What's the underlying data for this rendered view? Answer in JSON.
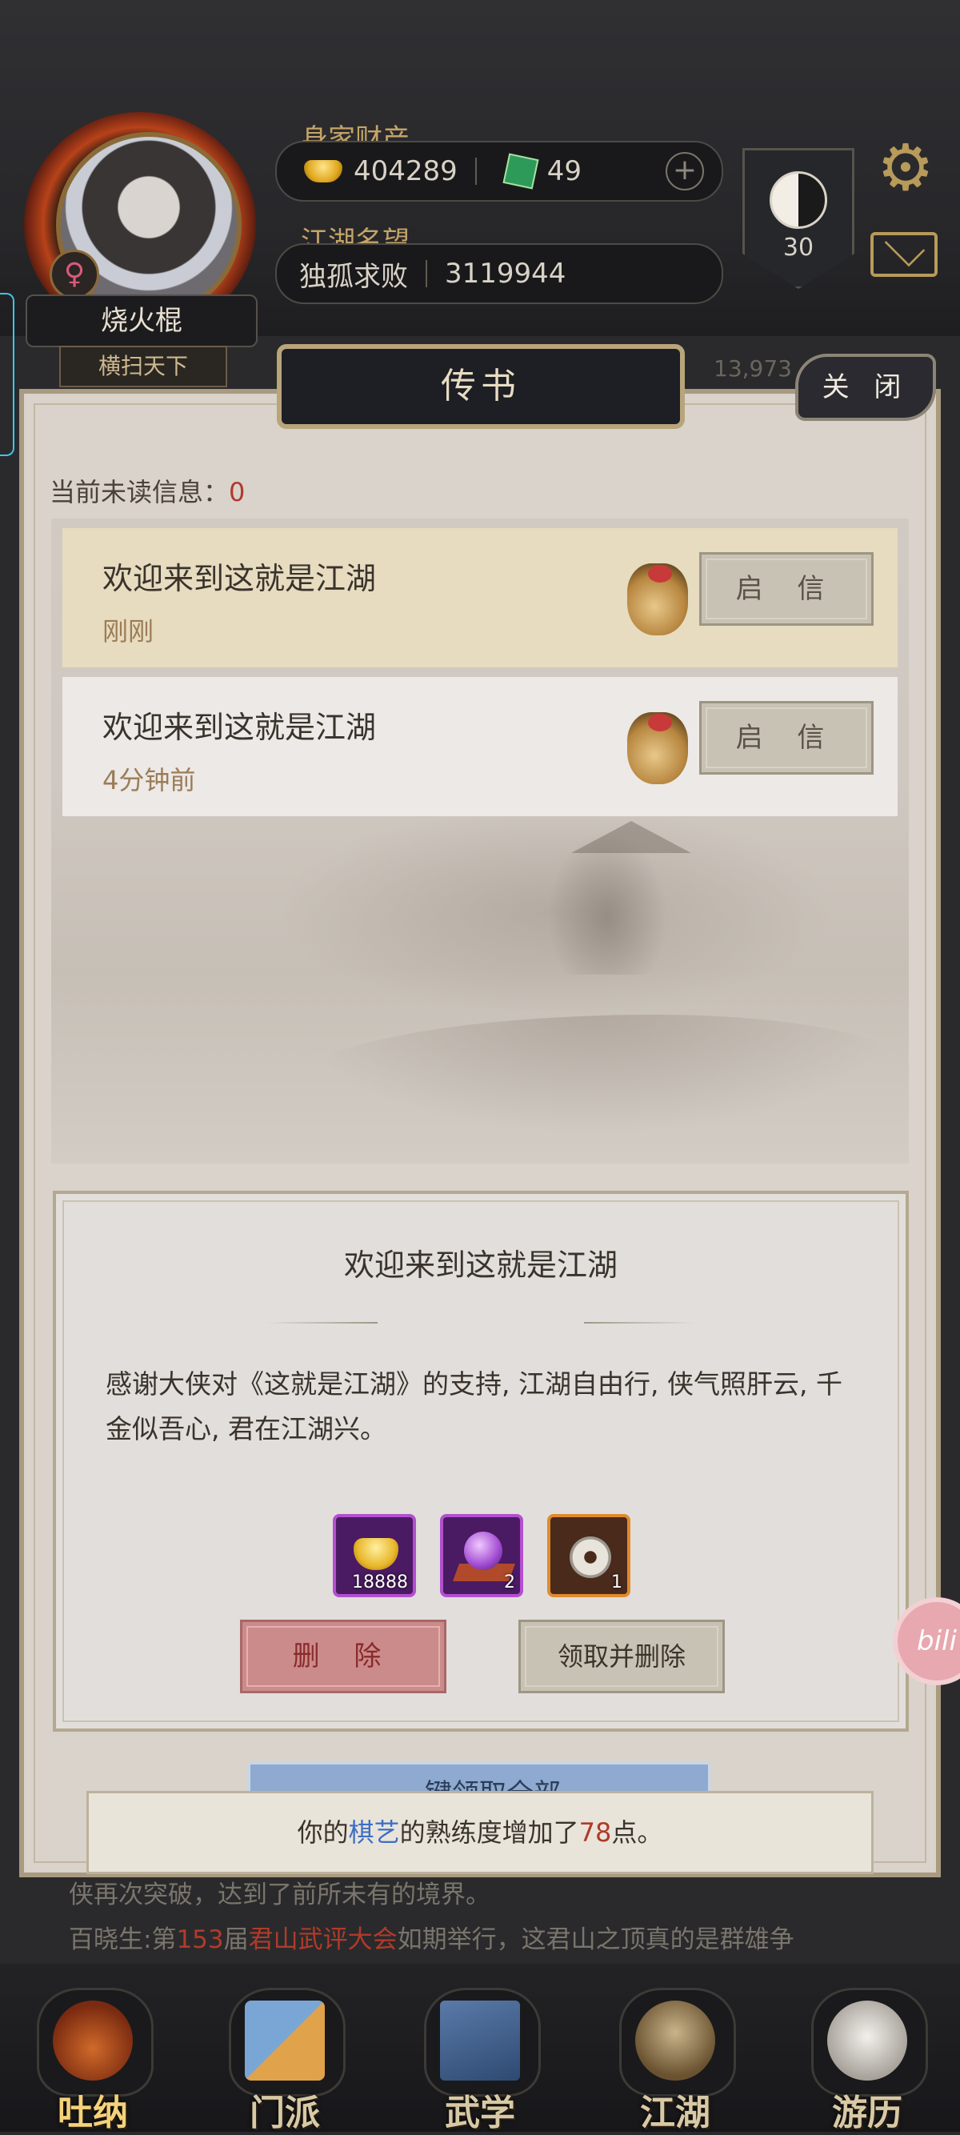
{
  "header": {
    "player_name": "烧火棍",
    "player_title": "横扫天下",
    "gender_symbol": "♀",
    "wealth_label": "身家财产",
    "silver": "404289",
    "jade": "49",
    "plus_symbol": "+",
    "reputation_label": "江湖名望",
    "reputation_title": "独孤求败",
    "reputation_value": "3119944",
    "level": "30",
    "settings_icon": "gear-icon",
    "mail_icon": "envelope-icon"
  },
  "panel": {
    "title": "传书",
    "close_label": "关 闭",
    "background_number": "13,973",
    "unread_label": "当前未读信息：",
    "unread_count": "0",
    "mails": [
      {
        "subject": "欢迎来到这就是江湖",
        "time": "刚刚",
        "open_label": "启 信",
        "selected": true
      },
      {
        "subject": "欢迎来到这就是江湖",
        "time": "4分钟前",
        "open_label": "启 信",
        "selected": false
      }
    ]
  },
  "detail": {
    "title": "欢迎来到这就是江湖",
    "body": "感谢大侠对《这就是江湖》的支持, 江湖自由行, 侠气照肝云, 千金似吾心, 君在江湖兴。",
    "rewards": [
      {
        "icon": "gold-ingot-icon",
        "count": "18888",
        "rarity": "purple"
      },
      {
        "icon": "purple-orb-icon",
        "count": "2",
        "rarity": "purple"
      },
      {
        "icon": "jade-disc-icon",
        "count": "1",
        "rarity": "orange"
      }
    ],
    "delete_label": "删 除",
    "claim_delete_label": "领取并删除"
  },
  "claim_all_label": "一键领取全部",
  "toast": {
    "prefix": "你的",
    "skill": "棋艺",
    "middle": "的熟练度增加了",
    "value": "78",
    "suffix": "点。"
  },
  "news": {
    "line1": "侠再次突破，达到了前所未有的境界。",
    "line2_prefix": "百晓生:第",
    "line2_num": "153",
    "line2_mid": "届",
    "line2_event": "君山武评大会",
    "line2_suffix": "如期举行，这君山之顶真的是群雄争"
  },
  "nav": [
    {
      "label": "吐纳",
      "icon": "gourd-icon",
      "active": true
    },
    {
      "label": "门派",
      "icon": "banner-icon",
      "active": false
    },
    {
      "label": "武学",
      "icon": "scroll-book-icon",
      "active": false
    },
    {
      "label": "江湖",
      "icon": "straw-hat-icon",
      "active": false
    },
    {
      "label": "游历",
      "icon": "horse-icon",
      "active": false
    }
  ],
  "float_button": "bili",
  "colors": {
    "accent_gold": "#c4a467",
    "highlight_red": "#b03a2a",
    "skill_blue": "#3d6ec4",
    "panel_bg": "#d9d3cc"
  }
}
